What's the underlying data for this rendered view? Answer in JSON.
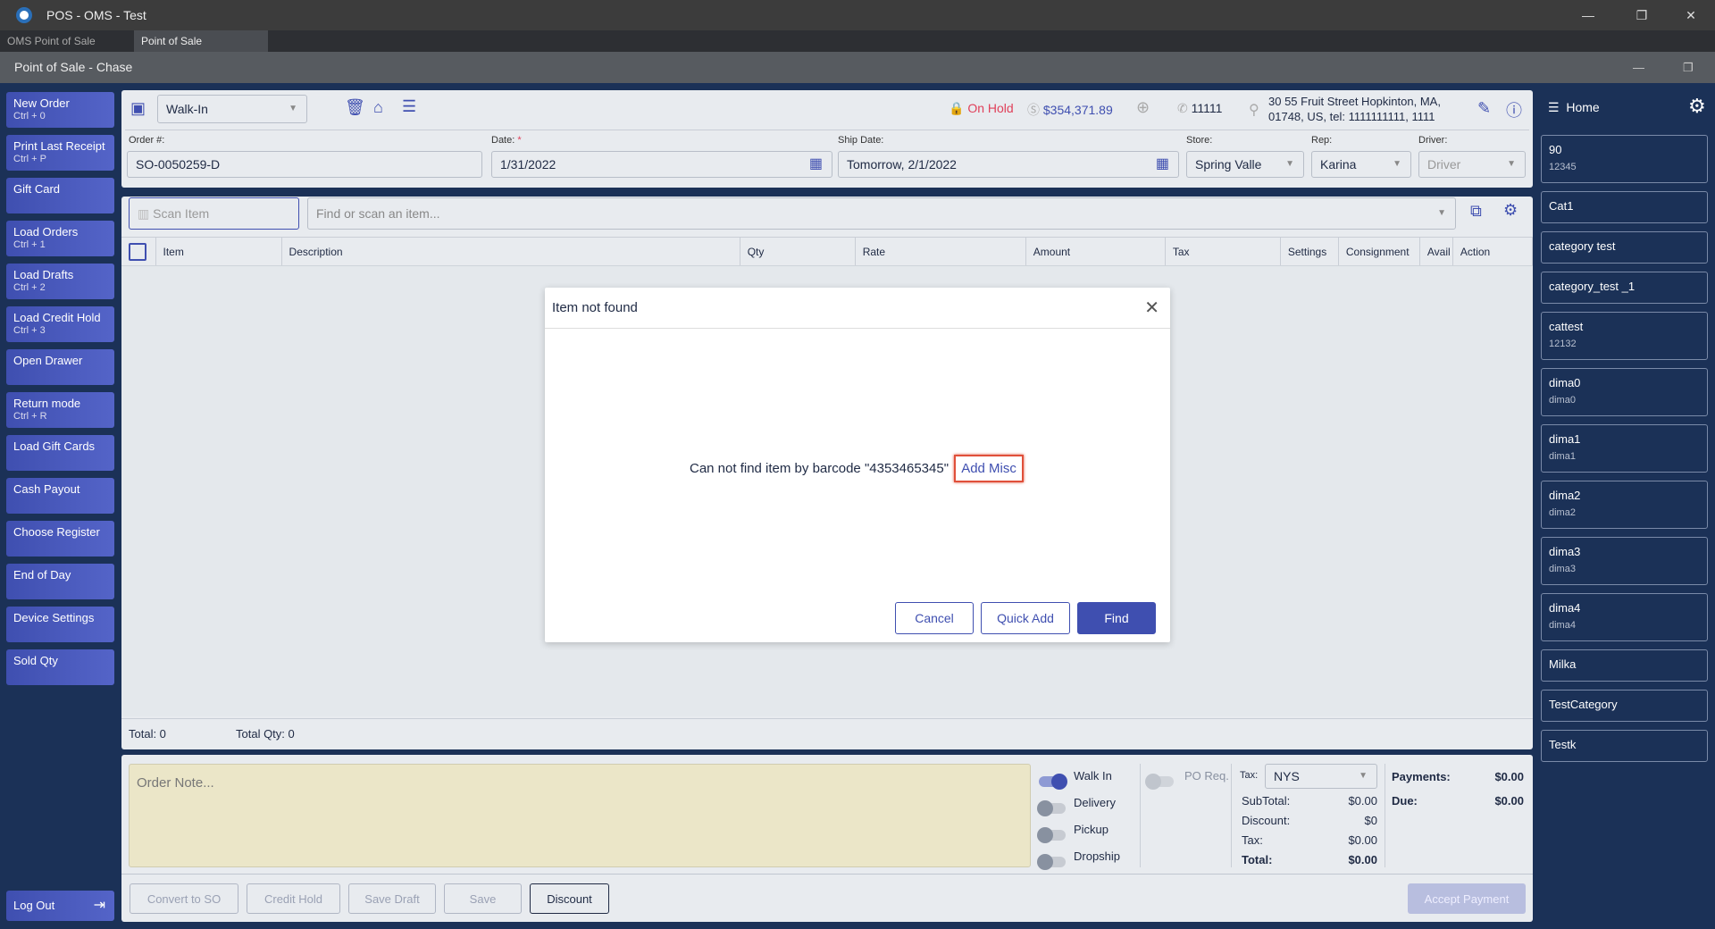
{
  "window": {
    "title": "POS - OMS - Test",
    "minimize": "—",
    "restore": "❐",
    "close": "✕"
  },
  "tabs": [
    {
      "label": "OMS Point of Sale"
    },
    {
      "label": "Point of Sale"
    }
  ],
  "subheader": {
    "title": "Point of Sale - Chase"
  },
  "left_menu": [
    {
      "label": "New Order",
      "shortcut": "Ctrl + 0"
    },
    {
      "label": "Print Last Receipt",
      "shortcut": "Ctrl + P"
    },
    {
      "label": "Gift Card",
      "shortcut": ""
    },
    {
      "label": "Load Orders",
      "shortcut": "Ctrl + 1"
    },
    {
      "label": "Load Drafts",
      "shortcut": "Ctrl + 2"
    },
    {
      "label": "Load Credit Hold",
      "shortcut": "Ctrl + 3"
    },
    {
      "label": "Open Drawer",
      "shortcut": ""
    },
    {
      "label": "Return mode",
      "shortcut": "Ctrl + R"
    },
    {
      "label": "Load Gift Cards",
      "shortcut": ""
    },
    {
      "label": "Cash Payout",
      "shortcut": ""
    },
    {
      "label": "Choose Register",
      "shortcut": ""
    },
    {
      "label": "End of Day",
      "shortcut": ""
    },
    {
      "label": "Device Settings",
      "shortcut": ""
    },
    {
      "label": "Sold Qty",
      "shortcut": ""
    }
  ],
  "logout": "Log Out",
  "header": {
    "customer": "Walk-In",
    "status": "On Hold",
    "balance": "$354,371.89",
    "phone": "11111",
    "address_line1": "30 55 Fruit Street Hopkinton, MA,",
    "address_line2": "01748, US,  tel: 1111111111,  1111"
  },
  "order": {
    "order_label": "Order #:",
    "order_value": "SO-0050259-D",
    "date_label": "Date:",
    "date_required": "*",
    "date_value": "1/31/2022",
    "ship_label": "Ship Date:",
    "ship_value": "Tomorrow, 2/1/2022",
    "store_label": "Store:",
    "store_value": "Spring Valle",
    "rep_label": "Rep:",
    "rep_value": "Karina",
    "driver_label": "Driver:",
    "driver_placeholder": "Driver"
  },
  "scan": {
    "scan_placeholder": "Scan Item",
    "find_placeholder": "Find or scan an item..."
  },
  "table": {
    "columns": [
      "Item",
      "Description",
      "Qty",
      "Rate",
      "Amount",
      "Tax",
      "Settings",
      "Consignment",
      "Avail",
      "Action"
    ]
  },
  "totals_bar": {
    "total": "Total: 0",
    "total_qty": "Total Qty: 0"
  },
  "dialog": {
    "title": "Item not found",
    "message": "Can not find item by barcode \"4353465345\"",
    "link": "Add Misc",
    "cancel": "Cancel",
    "quick_add": "Quick Add",
    "find": "Find"
  },
  "bottom": {
    "note_placeholder": "Order Note...",
    "walk_in": "Walk In",
    "delivery": "Delivery",
    "pickup": "Pickup",
    "dropship": "Dropship",
    "po_req": "PO Req.",
    "tax_label": "Tax:",
    "tax_value": "NYS",
    "subtotal_label": "SubTotal:",
    "subtotal": "$0.00",
    "discount_label": "Discount:",
    "discount": "$0",
    "tax2_label": "Tax:",
    "tax2": "$0.00",
    "total_label": "Total:",
    "total": "$0.00",
    "payments_label": "Payments:",
    "payments": "$0.00",
    "due_label": "Due:",
    "due": "$0.00"
  },
  "actions": {
    "convert": "Convert to SO",
    "credit_hold": "Credit Hold",
    "save_draft": "Save Draft",
    "save": "Save",
    "discount": "Discount",
    "accept_payment": "Accept Payment"
  },
  "right": {
    "home": "Home",
    "categories": [
      {
        "name": "90",
        "sub": "12345"
      },
      {
        "name": "Cat1",
        "sub": ""
      },
      {
        "name": "category test",
        "sub": ""
      },
      {
        "name": "category_test _1",
        "sub": ""
      },
      {
        "name": "cattest",
        "sub": "12132"
      },
      {
        "name": "dima0",
        "sub": "dima0"
      },
      {
        "name": "dima1",
        "sub": "dima1"
      },
      {
        "name": "dima2",
        "sub": "dima2"
      },
      {
        "name": "dima3",
        "sub": "dima3"
      },
      {
        "name": "dima4",
        "sub": "dima4"
      },
      {
        "name": "Milka",
        "sub": ""
      },
      {
        "name": "TestCategory",
        "sub": ""
      },
      {
        "name": "Testk",
        "sub": ""
      }
    ]
  }
}
